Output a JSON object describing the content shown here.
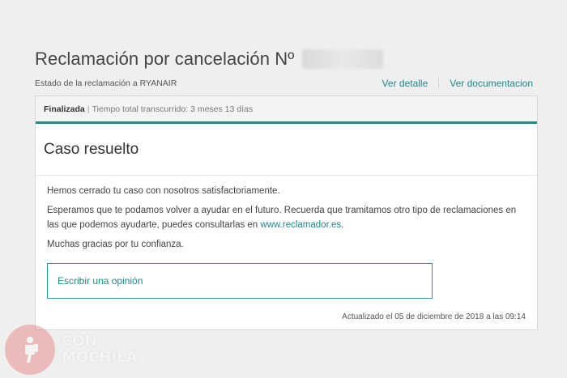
{
  "header": {
    "title": "Reclamación por cancelación Nº",
    "subtitle": "Estado de la reclamación a RYANAIR",
    "links": {
      "detail": "Ver detalle",
      "documents": "Ver documentacion"
    }
  },
  "status": {
    "state": "Finalizada",
    "separator": "|",
    "elapsed": "Tiempo total transcurrido: 3 meses 13 días"
  },
  "case": {
    "title": "Caso resuelto",
    "paragraph_1": "Hemos cerrado tu caso con nosotros satisfactoriamente.",
    "paragraph_2_text": "Esperamos que te podamos volver a ayudar en el futuro. Recuerda que tramitamos otro tipo de reclamaciones en las que podemos ayudarte, puedes consultarlas en ",
    "paragraph_2_link": "www.reclamador.es",
    "paragraph_2_end": ".",
    "paragraph_3": "Muchas gracias por tu confianza.",
    "review_button": "Escribir una opinión",
    "updated": "Actualizado el 05 de diciembre de 2018 a las 09:14"
  },
  "watermark": {
    "line_1": "CON",
    "line_2": "MOCHILA"
  },
  "colors": {
    "accent": "#1f8c8a",
    "link": "#21888a",
    "background": "#efefef",
    "watermark_logo": "#e45a5a"
  },
  "icons": {
    "watermark": "hiker-icon"
  }
}
